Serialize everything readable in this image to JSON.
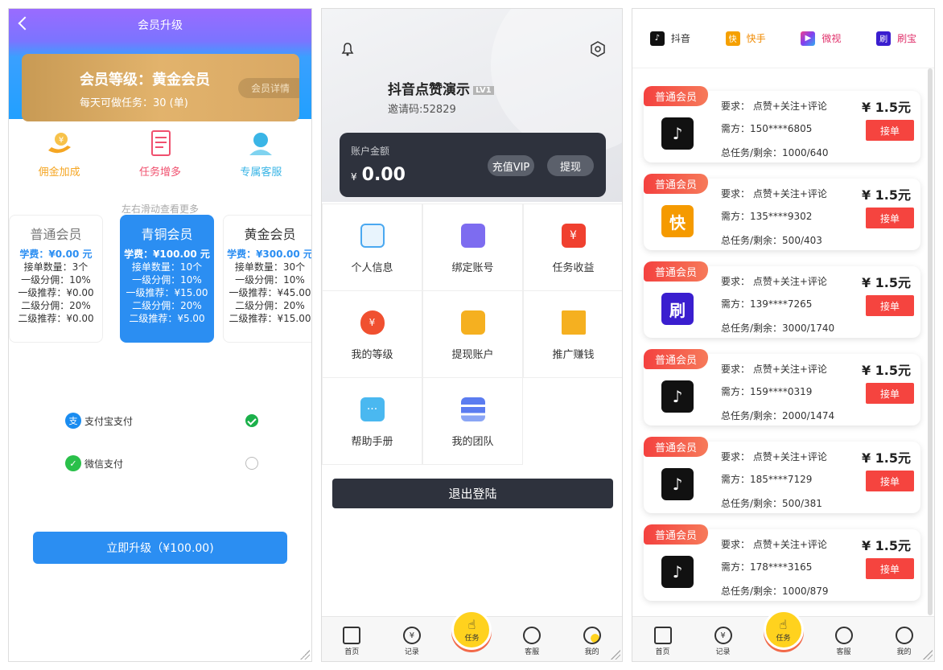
{
  "upgrade": {
    "title": "会员升级",
    "level": "会员等级：黄金会员",
    "daily": "每天可做任务：30 (单)",
    "detail": "会员详情",
    "perks": [
      "佣金加成",
      "任务增多",
      "专属客服"
    ],
    "perk_colors": [
      "#f5a623",
      "#f0506e",
      "#3ab5e6"
    ],
    "hint": "左右滑动查看更多",
    "tiers": [
      {
        "name": "普通会员",
        "fee": "学费：¥0.00 元",
        "rows": [
          "接单数量：3个",
          "一级分佣：10%",
          "一级推荐：¥0.00",
          "二级分佣：20%",
          "二级推荐：¥0.00"
        ]
      },
      {
        "name": "青铜会员",
        "fee": "学费：¥100.00 元",
        "rows": [
          "接单数量：10个",
          "一级分佣：10%",
          "一级推荐：¥15.00",
          "二级分佣：20%",
          "二级推荐：¥5.00"
        ]
      },
      {
        "name": "黄金会员",
        "fee": "学费：¥300.00 元",
        "rows": [
          "接单数量：30个",
          "一级分佣：10%",
          "一级推荐：¥45.00",
          "二级分佣：20%",
          "二级推荐：¥15.00"
        ]
      }
    ],
    "pay": [
      {
        "label": "支付宝支付",
        "selected": true
      },
      {
        "label": "微信支付",
        "selected": false
      }
    ],
    "button": "立即升级（¥100.00)"
  },
  "profile": {
    "name": "抖音点赞演示",
    "level": "LV1",
    "invite": "邀请码:52829",
    "balance_label": "账户金额",
    "currency": "¥",
    "balance": "0.00",
    "vip": "充值VIP",
    "withdraw": "提现",
    "menu": [
      "个人信息",
      "绑定账号",
      "任务收益",
      "我的等级",
      "提现账户",
      "推广赚钱",
      "帮助手册",
      "我的团队"
    ],
    "menu_colors": [
      "#4aa8f0",
      "#7d6cf0",
      "#f0402f",
      "#f05030",
      "#f5b020",
      "#f5b020",
      "#4ab8f0",
      "#5b7cf0"
    ],
    "logout": "退出登陆"
  },
  "tabs": {
    "home": "首页",
    "record": "记录",
    "task": "任务",
    "service": "客服",
    "mine": "我的",
    "record_glyph": "¥"
  },
  "tasks": {
    "platforms": [
      {
        "name": "抖音",
        "color": "#111",
        "glyph": "♪",
        "text_color": "#333"
      },
      {
        "name": "快手",
        "color": "#f5a000",
        "glyph": "快",
        "text_color": "#f08a00"
      },
      {
        "name": "微视",
        "color": "#a040f0",
        "glyph": "▶",
        "text_color": "#e0306a"
      },
      {
        "name": "刷宝",
        "color": "#3a1ecf",
        "glyph": "刷",
        "text_color": "#e0306a"
      }
    ],
    "orders": [
      {
        "badge": "普通会员",
        "req": "要求：  点赞+关注+评论",
        "need": "需方：150****6805",
        "rem": "总任务/剩余：1000/640",
        "price": "¥ 1.5元",
        "take": "接单",
        "logo": "♪",
        "logo_color": "#111"
      },
      {
        "badge": "普通会员",
        "req": "要求：  点赞+关注+评论",
        "need": "需方：135****9302",
        "rem": "总任务/剩余：500/403",
        "price": "¥ 1.5元",
        "take": "接单",
        "logo": "快",
        "logo_color": "#f59a00"
      },
      {
        "badge": "普通会员",
        "req": "要求：  点赞+关注+评论",
        "need": "需方：139****7265",
        "rem": "总任务/剩余：3000/1740",
        "price": "¥ 1.5元",
        "take": "接单",
        "logo": "刷",
        "logo_color": "#3a1ecf"
      },
      {
        "badge": "普通会员",
        "req": "要求：  点赞+关注+评论",
        "need": "需方：159****0319",
        "rem": "总任务/剩余：2000/1474",
        "price": "¥ 1.5元",
        "take": "接单",
        "logo": "♪",
        "logo_color": "#111"
      },
      {
        "badge": "普通会员",
        "req": "要求：  点赞+关注+评论",
        "need": "需方：185****7129",
        "rem": "总任务/剩余：500/381",
        "price": "¥ 1.5元",
        "take": "接单",
        "logo": "♪",
        "logo_color": "#111"
      },
      {
        "badge": "普通会员",
        "req": "要求：  点赞+关注+评论",
        "need": "需方：178****3165",
        "rem": "总任务/剩余：1000/879",
        "price": "¥ 1.5元",
        "take": "接单",
        "logo": "♪",
        "logo_color": "#111"
      }
    ]
  }
}
